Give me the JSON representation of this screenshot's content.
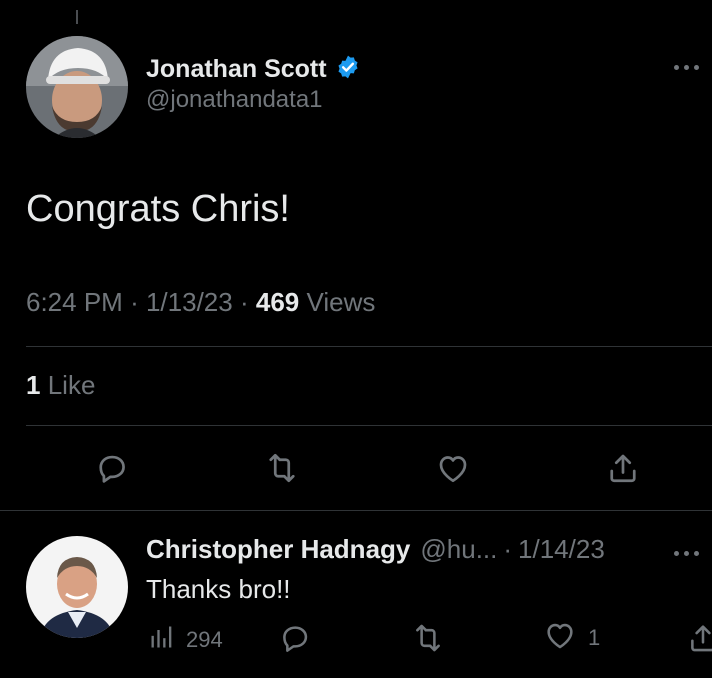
{
  "tweet": {
    "author": {
      "display_name": "Jonathan Scott",
      "handle": "@jonathandata1",
      "verified": true,
      "avatar_icon": "avatar-person-white-cap"
    },
    "text": "Congrats Chris!",
    "time": "6:24 PM",
    "date": "1/13/23",
    "separator": "·",
    "views_count": "469",
    "views_label": "Views",
    "likes_count": "1",
    "likes_label": "Like",
    "actions": [
      "reply-icon",
      "retweet-icon",
      "like-icon",
      "share-icon"
    ]
  },
  "reply": {
    "author": {
      "display_name": "Christopher Hadnagy",
      "handle": "@hu...",
      "avatar_icon": "avatar-person-suit"
    },
    "separator": "·",
    "date": "1/14/23",
    "text": "Thanks bro!!",
    "views_count": "294",
    "like_count": "1"
  },
  "colors": {
    "background": "#000000",
    "text_primary": "#e7e9ea",
    "text_secondary": "#71767b",
    "verified_badge": "#1d9bf0",
    "divider": "#2f3336"
  }
}
